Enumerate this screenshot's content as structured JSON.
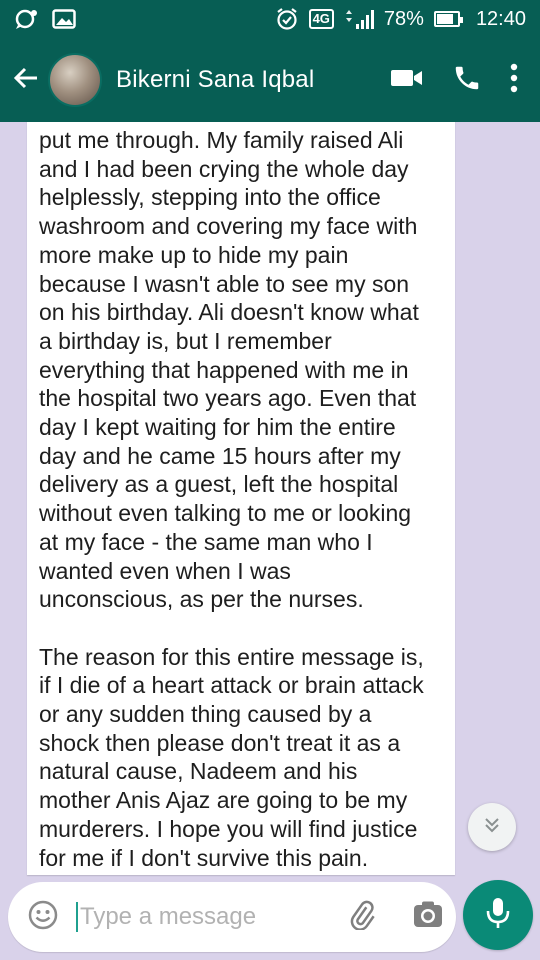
{
  "status_bar": {
    "network": "4G",
    "battery": "78%",
    "battery_level": 0.78,
    "time": "12:40",
    "icons": [
      "chat-bubble-icon",
      "image-icon",
      "alarm-icon",
      "signal-icon",
      "battery-icon"
    ]
  },
  "header": {
    "contact_name": "Bikerni Sana Iqbal",
    "icons": [
      "back-arrow-icon",
      "video-call-icon",
      "phone-icon",
      "more-options-icon"
    ]
  },
  "message": {
    "paragraph_1": "put me through. My family raised Ali\nand I had been crying the whole day\nhelplessly, stepping into the office\nwashroom and covering my face with\nmore make up to hide my pain\nbecause I wasn't able to see my son\non his birthday. Ali doesn't know what\na birthday is, but I remember\neverything that happened with me in\nthe hospital two years ago. Even that\nday I kept waiting for him the entire\nday and he came 15 hours after my\ndelivery as a guest, left the hospital\nwithout even talking to me or looking\nat my face - the same man who I\nwanted even when I was\nunconscious, as per the nurses.",
    "paragraph_2": "The reason for this entire message is,\nif I die of a heart attack or brain attack\nor any sudden thing caused by a\nshock then please don't treat it as a\nnatural cause, Nadeem and his\nmother Anis Ajaz are going to be my\nmurderers. I hope you will find justice\nfor me if I don't survive this pain."
  },
  "composer": {
    "placeholder": "Type a message",
    "icons": [
      "emoji-icon",
      "attach-icon",
      "camera-icon",
      "mic-icon",
      "chevron-double-down-icon"
    ]
  },
  "colors": {
    "header": "#075e54",
    "background": "#d9d2ea",
    "accent": "#0a8a77"
  }
}
